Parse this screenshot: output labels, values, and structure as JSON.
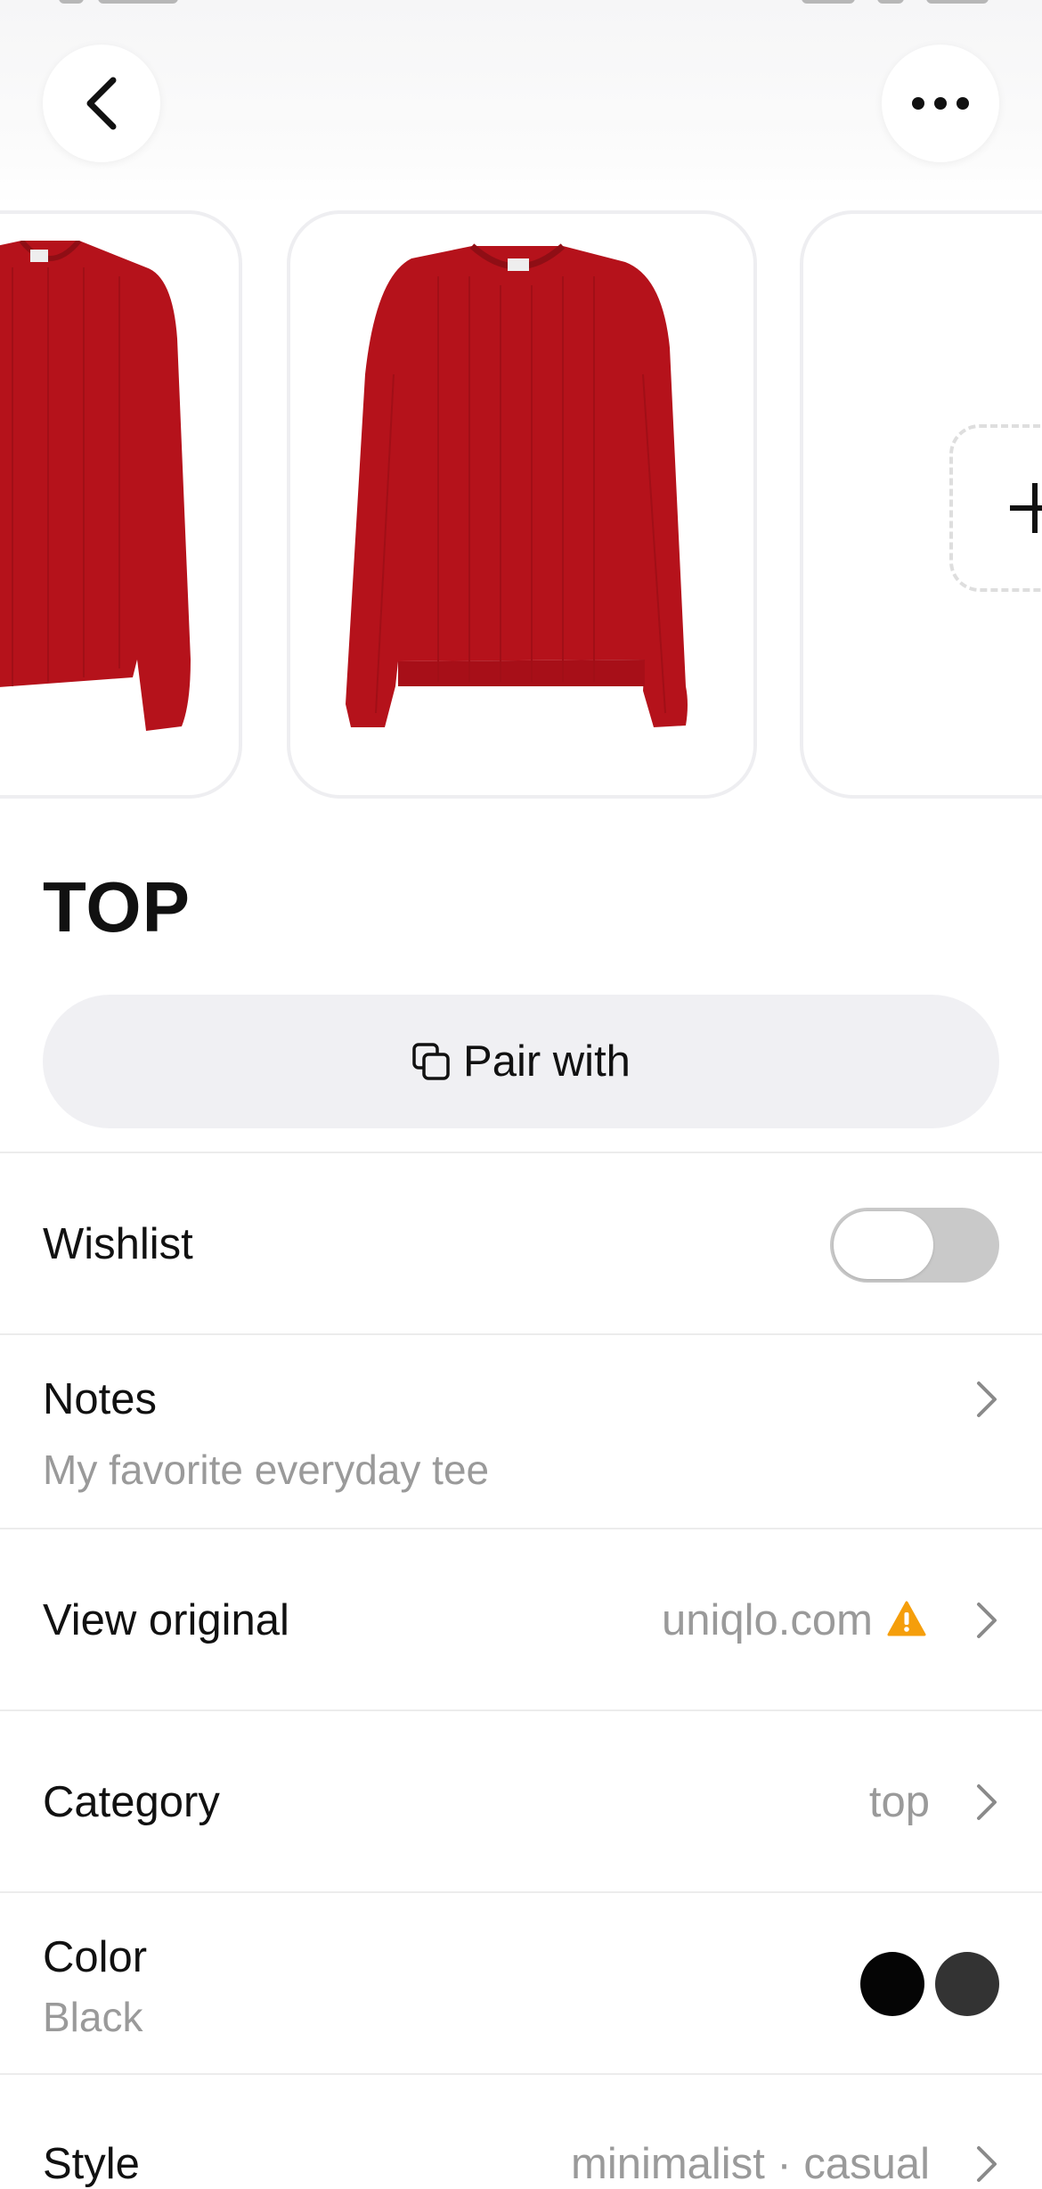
{
  "header": {
    "back_icon": "chevron-left-icon",
    "more_icon": "ellipsis-icon"
  },
  "carousel": {
    "items": [
      {
        "description_icon": "red-ribbed-sweater",
        "color": "#b5121b"
      },
      {
        "description_icon": "red-ribbed-sweater",
        "color": "#b5121b"
      },
      {
        "description_icon": "add-photo-icon"
      }
    ]
  },
  "item": {
    "title": "TOP",
    "pair_button": {
      "label": "Pair with",
      "icon": "copy-icon"
    }
  },
  "rows": {
    "wishlist": {
      "label": "Wishlist",
      "enabled": false
    },
    "notes": {
      "label": "Notes",
      "value": "My favorite everyday tee"
    },
    "view_original": {
      "label": "View original",
      "value": "uniqlo.com",
      "warning_icon": "warning-icon",
      "warning_color": "#f59e0b"
    },
    "category": {
      "label": "Category",
      "value": "top"
    },
    "color": {
      "label": "Color",
      "value": "Black",
      "swatches": [
        "#050505",
        "#333333"
      ]
    },
    "style": {
      "label": "Style",
      "value": "minimalist · casual"
    }
  }
}
